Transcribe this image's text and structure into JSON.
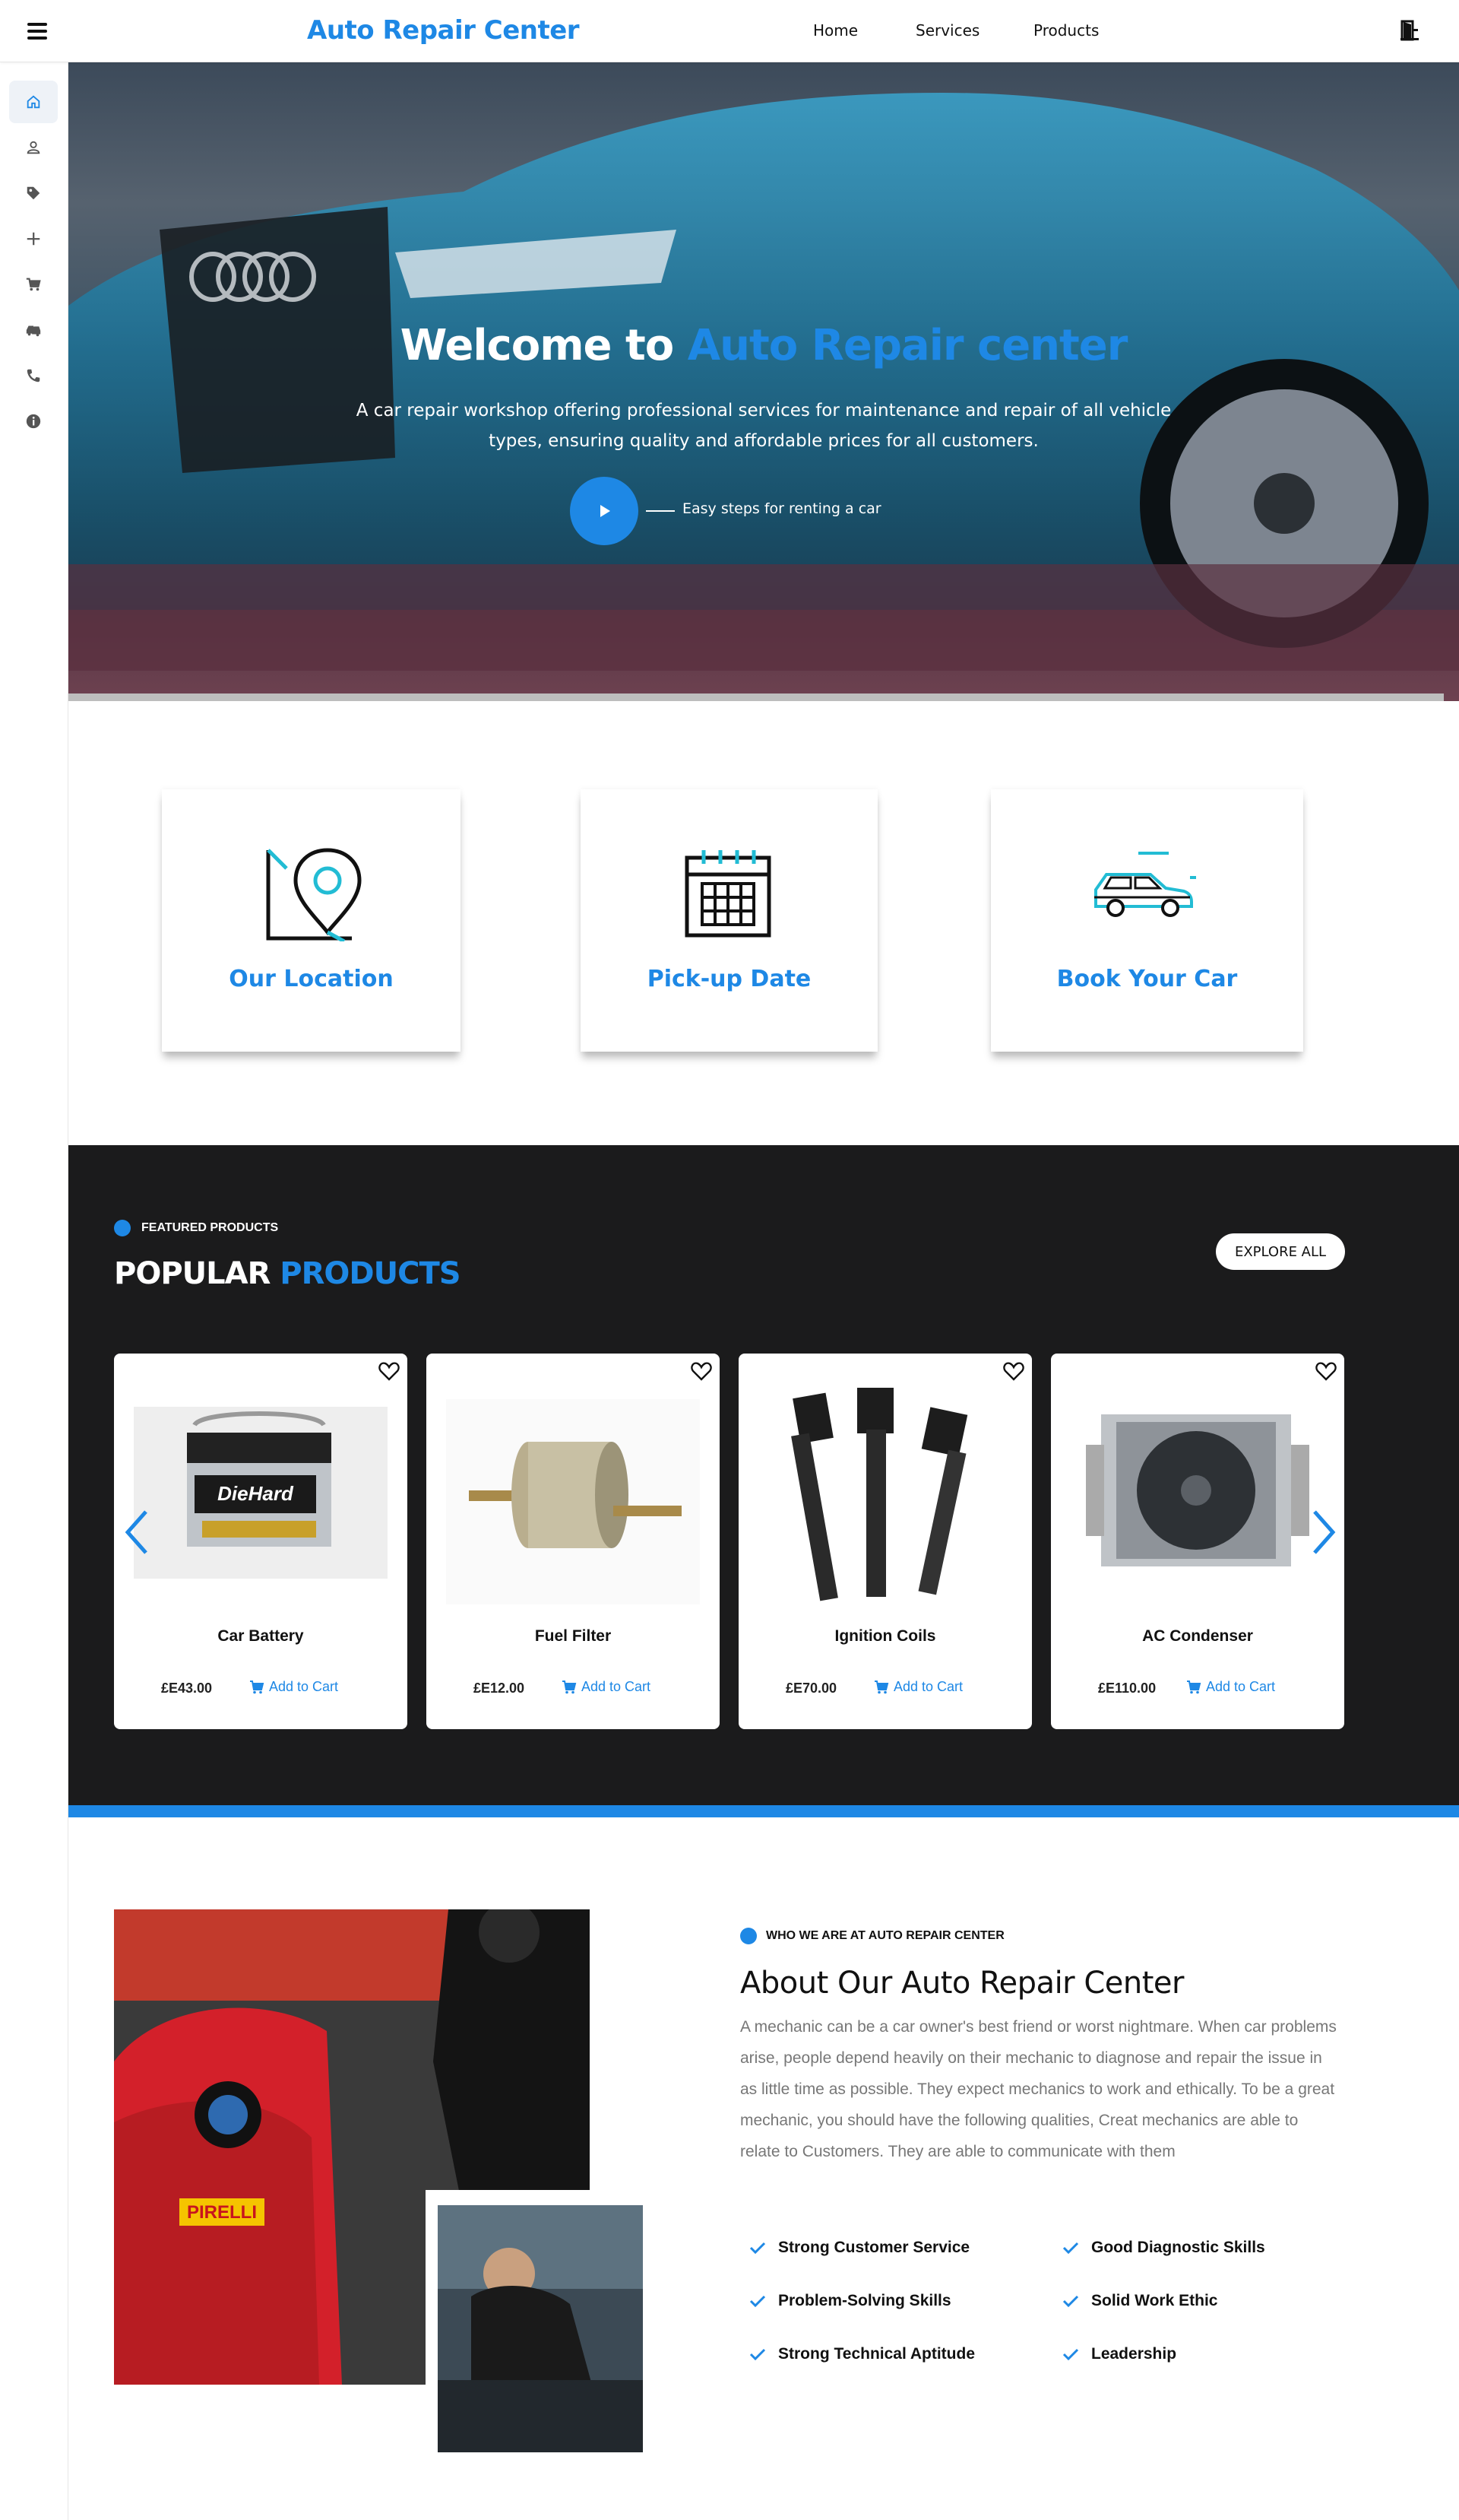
{
  "app": {
    "brand": "Auto Repair Center"
  },
  "nav": {
    "home": "Home",
    "services": "Services",
    "products": "Products"
  },
  "sidebar": {
    "items": [
      {
        "icon": "home-icon",
        "active": true
      },
      {
        "icon": "user-icon"
      },
      {
        "icon": "tag-icon"
      },
      {
        "icon": "plus-icon"
      },
      {
        "icon": "cart-icon"
      },
      {
        "icon": "cars-icon"
      },
      {
        "icon": "phone-icon"
      },
      {
        "icon": "info-icon"
      }
    ]
  },
  "hero": {
    "title_prefix": "Welcome to ",
    "title_accent": "Auto Repair center",
    "subtitle": "A car repair workshop offering professional services for maintenance and repair of all vehicle types, ensuring quality and affordable prices for all customers.",
    "play_label": "Easy steps for renting a car"
  },
  "features": [
    {
      "title": "Our Location",
      "icon": "location-icon"
    },
    {
      "title": "Pick-up Date",
      "icon": "calendar-icon"
    },
    {
      "title": "Book Your Car",
      "icon": "car-icon"
    }
  ],
  "products": {
    "eyebrow": "FEATURED PRODUCTS",
    "title_prefix": "POPULAR ",
    "title_accent": "PRODUCTS",
    "explore_label": "EXPLORE ALL",
    "cart_label": "Add to Cart",
    "items": [
      {
        "name": "Car Battery",
        "price": "£E43.00"
      },
      {
        "name": "Fuel Filter",
        "price": "£E12.00"
      },
      {
        "name": "Ignition Coils",
        "price": "£E70.00"
      },
      {
        "name": "AC Condenser",
        "price": "£E110.00"
      }
    ]
  },
  "about": {
    "eyebrow": "WHO WE ARE AT AUTO REPAIR CENTER",
    "title": "About Our Auto Repair Center",
    "text": "A mechanic can be a car owner's best friend or worst nightmare. When car problems arise, people depend heavily on their mechanic to diagnose and repair the issue in as little time as possible. They expect mechanics to work and ethically. To be a great mechanic, you should have the following qualities, Creat mechanics are able to relate to Customers. They are able to communicate with them",
    "qualities": [
      "Strong Customer Service",
      "Good Diagnostic Skills",
      "Problem-Solving Skills",
      "Solid Work Ethic",
      "Strong Technical Aptitude",
      "Leadership"
    ]
  },
  "colors": {
    "accent": "#1e88e5",
    "dark": "#1b1b1c"
  }
}
